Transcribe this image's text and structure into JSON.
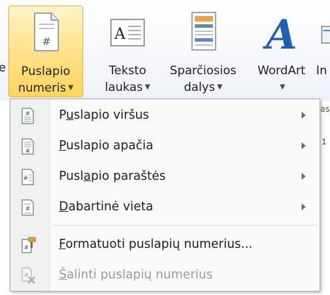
{
  "ribbon": {
    "left_edge_text": "e",
    "buttons": [
      {
        "line1": "Puslapio",
        "line2": "numeris",
        "icon": "page-number-icon",
        "active": true
      },
      {
        "line1": "Teksto",
        "line2": "laukas",
        "icon": "text-box-icon"
      },
      {
        "line1": "Sparčiosios",
        "line2": "dalys",
        "icon": "quick-parts-icon"
      },
      {
        "line1": "WordArt",
        "line2": "",
        "icon": "wordart-icon"
      },
      {
        "line1": "In",
        "line2": "",
        "icon": "insert-partial-icon"
      }
    ],
    "right_edge_text_1": "as",
    "right_edge_text_2": "1"
  },
  "menu": {
    "items": [
      {
        "pre": "P",
        "u": "u",
        "post": "slapio viršus",
        "icon": "page-top-icon",
        "submenu": true
      },
      {
        "pre": "",
        "u": "P",
        "post": "uslapio apačia",
        "icon": "page-bottom-icon",
        "submenu": true
      },
      {
        "pre": "Pusl",
        "u": "a",
        "post": "pio paraštės",
        "icon": "page-margins-icon",
        "submenu": true
      },
      {
        "pre": "",
        "u": "D",
        "post": "abartinė vieta",
        "icon": "current-position-icon",
        "submenu": true
      },
      {
        "pre": "",
        "u": "F",
        "post": "ormatuoti puslapių numerius...",
        "icon": "format-page-numbers-icon",
        "submenu": false
      },
      {
        "pre": "",
        "u": "Š",
        "post": "alinti puslapių numerius",
        "icon": "remove-page-numbers-icon",
        "submenu": false,
        "disabled": true
      }
    ]
  },
  "colors": {
    "active_button_top": "#fff4c9",
    "active_button_bottom": "#ffd65c",
    "active_border": "#e3b24f",
    "wordart_blue": "#1f5fb5",
    "disabled_text": "#9a9a9a"
  }
}
